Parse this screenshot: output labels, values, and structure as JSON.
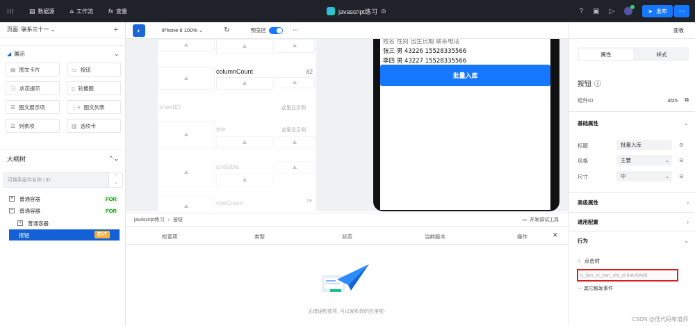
{
  "topbar": {
    "nav": [
      {
        "icon": "database-icon",
        "label": "数据源"
      },
      {
        "icon": "workflow-icon",
        "label": "工作流"
      },
      {
        "icon": "function-icon",
        "label": "变量"
      }
    ],
    "app_title": "javascript练习",
    "publish_label": "发布"
  },
  "left": {
    "page_label": "页面: 联系三十一",
    "section_title": "展示",
    "components": [
      {
        "icon": "card-icon",
        "label": "图文卡片"
      },
      {
        "icon": "button-icon",
        "label": "按钮"
      },
      {
        "icon": "status-icon",
        "label": "状态提示"
      },
      {
        "icon": "carousel-icon",
        "label": "轮播图"
      },
      {
        "icon": "image-text-icon",
        "label": "图文展示项"
      },
      {
        "icon": "list-icon",
        "label": "图文列表"
      },
      {
        "icon": "list-item-icon",
        "label": "列表项"
      },
      {
        "icon": "tabs-icon",
        "label": "选项卡"
      }
    ],
    "outline_title": "大纲树",
    "search_placeholder": "可搜索组件名称 / ID",
    "tree": [
      {
        "label": "普通容器",
        "tag": "FOR",
        "toggle": "+"
      },
      {
        "label": "普通容器",
        "tag": "FOR",
        "toggle": "−"
      },
      {
        "label": "普通容器",
        "tag": "",
        "toggle": "+"
      }
    ],
    "selected_node": {
      "label": "按钮",
      "tag": "EVT"
    }
  },
  "center": {
    "device": "iPhone 8 100% ⌄",
    "preview_label": "预览区",
    "table": {
      "header": "columnCount",
      "header_value": "82",
      "rows": [
        {
          "label": "sheetID",
          "value": "这里显示例"
        },
        {
          "label": "title",
          "value": "这里显示例"
        },
        {
          "label": "isVisible",
          "value": ""
        },
        {
          "label": "rowCount",
          "value": "19"
        }
      ]
    },
    "phone_lines": [
      "姓名 性别 出生日期 联系电话",
      "张三 男 43226 15528335566",
      "李四 男 43227 15528335566"
    ],
    "batch_button": "批量入库"
  },
  "bottom": {
    "breadcrumb": [
      "javascript练习",
      "按钮"
    ],
    "dev_tools": "开发调试工具",
    "columns": [
      "检查项",
      "类型",
      "状态",
      "当前版本",
      "操作"
    ],
    "empty_text": "无错误检查项, 可以发布你的应用啦~"
  },
  "right": {
    "panel_label": "面板",
    "tabs": [
      "属性",
      "样式"
    ],
    "component_title": "按钮",
    "id_label": "组件ID",
    "id_value": "id25",
    "basic_section": "基础属性",
    "props": [
      {
        "label": "标题",
        "value": "批量入库",
        "dropdown": false
      },
      {
        "label": "风格",
        "value": "主要",
        "dropdown": true
      },
      {
        "label": "尺寸",
        "value": "中",
        "dropdown": true
      }
    ],
    "advanced_section": "高级属性",
    "common_section": "通用配置",
    "behavior_section": "行为",
    "click_label": "点击时",
    "handler": "u_lian_xi_san_shi_yi.batchAdd",
    "other_events": "其它触发事件"
  },
  "watermark": "CSDN @低代码布道师"
}
